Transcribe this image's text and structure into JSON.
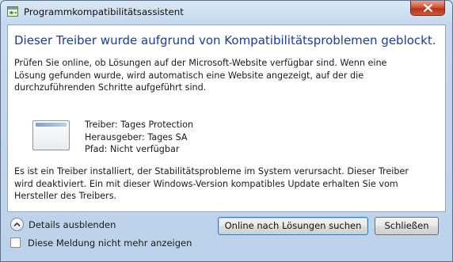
{
  "window": {
    "title": "Programmkompatibilitätsassistent"
  },
  "content": {
    "heading": "Dieser Treiber wurde aufgrund von Kompatibilitätsproblemen geblockt.",
    "description": "Prüfen Sie online, ob Lösungen auf der Microsoft-Website verfügbar sind. Wenn eine Lösung gefunden wurde, wird automatisch eine Website angezeigt, auf der die durchzuführenden Schritte aufgeführt sind.",
    "driver": {
      "name": "Treiber: Tages Protection",
      "publisher": "Herausgeber: Tages SA",
      "path": "Pfad: Nicht verfügbar"
    },
    "note": "Es ist ein Treiber installiert, der Stabilitätsprobleme im System verursacht. Dieser Treiber wird deaktiviert. Ein mit dieser Windows-Version kompatibles Update erhalten Sie vom Hersteller des Treibers."
  },
  "footer": {
    "details_toggle": "Details ausblenden",
    "dont_show_checkbox": "Diese Meldung nicht mehr anzeigen",
    "dont_show_checked": false,
    "online_button": "Online nach Lösungen suchen",
    "close_button": "Schließen"
  },
  "colors": {
    "heading": "#1b3d9a",
    "close_button": "#c4402a"
  },
  "icons": {
    "app": "compatibility-icon",
    "driver": "driver-window-icon",
    "close": "close-icon",
    "toggle": "chevron-up-icon"
  }
}
